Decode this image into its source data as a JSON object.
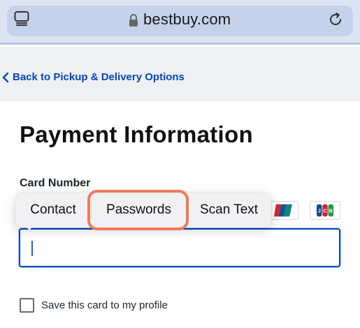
{
  "browser": {
    "url": "bestbuy.com",
    "icons": [
      "tabs-icon",
      "lock-icon",
      "reload-icon"
    ]
  },
  "nav": {
    "back_label": "Back to Pickup & Delivery Options"
  },
  "page": {
    "title": "Payment Information",
    "card_number_label": "Card Number",
    "card_number_value": "",
    "save_card_label": "Save this card to my profile",
    "save_card_checked": false
  },
  "card_logos": [
    "UnionPay",
    "JCB"
  ],
  "autofill_menu": {
    "items": [
      "Contact",
      "Passwords",
      "Scan Text"
    ],
    "highlighted": "Passwords"
  },
  "colors": {
    "link": "#0046be",
    "input_border": "#0046be",
    "highlight_ring": "#ee7a5b",
    "browser_bar": "#dce3f2"
  }
}
